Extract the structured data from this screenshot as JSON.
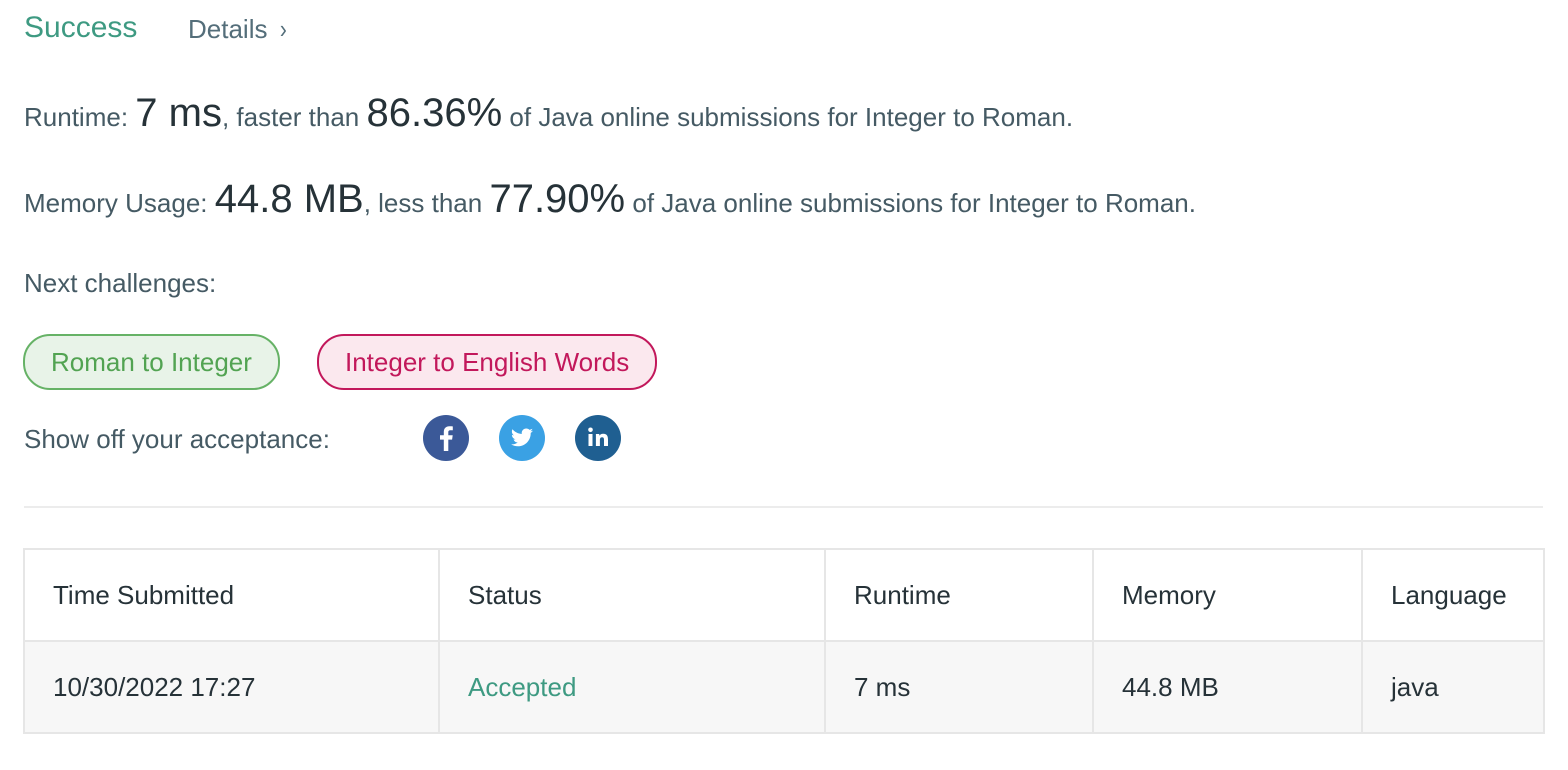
{
  "header": {
    "status": "Success",
    "details_label": "Details",
    "details_chevron": "›"
  },
  "runtime": {
    "label": "Runtime:",
    "value": "7 ms",
    "comparison": ", faster than",
    "percent": "86.36%",
    "suffix": "of Java online submissions for Integer to Roman."
  },
  "memory": {
    "label": "Memory Usage:",
    "value": "44.8 MB",
    "comparison": ", less than",
    "percent": "77.90%",
    "suffix": "of Java online submissions for Integer to Roman."
  },
  "next_challenges": {
    "label": "Next challenges:",
    "items": [
      {
        "label": "Roman to Integer",
        "difficulty_color": "#52a352"
      },
      {
        "label": "Integer to English Words",
        "difficulty_color": "#c2185b"
      }
    ]
  },
  "share": {
    "label": "Show off your acceptance:",
    "icons": [
      "facebook-icon",
      "twitter-icon",
      "linkedin-icon"
    ]
  },
  "submissions": {
    "columns": [
      "Time Submitted",
      "Status",
      "Runtime",
      "Memory",
      "Language"
    ],
    "rows": [
      {
        "time": "10/30/2022 17:27",
        "status": "Accepted",
        "runtime": "7 ms",
        "memory": "44.8 MB",
        "language": "java"
      }
    ]
  },
  "colors": {
    "success": "#3e9a82",
    "easy": "#52a352",
    "hard": "#c2185b",
    "facebook": "#3b5998",
    "twitter": "#3aa1e4",
    "linkedin": "#1f5f91"
  }
}
